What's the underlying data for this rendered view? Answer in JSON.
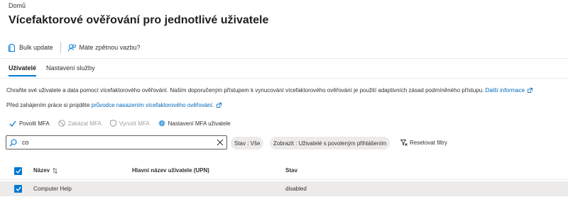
{
  "breadcrumb": "Domů",
  "page_title": "Vícefaktorové ověřování pro jednotlivé uživatele",
  "title_more": "···",
  "toolbar": {
    "bulk_update": "Bulk update",
    "feedback": "Máte zpětnou vazbu?"
  },
  "tabs": [
    {
      "label": "Uživatelé",
      "active": true
    },
    {
      "label": "Nastavení služby",
      "active": false
    }
  ],
  "description": {
    "text": "Chraňte své uživatele a data pomocí vícefaktorového ověřování. Naším doporučeným přístupem k vynucování vícefaktorového ověřování je použití adaptivních zásad podmíněného přístupu.",
    "link": "Další informace"
  },
  "guide": {
    "text": "Před zahájením práce si projděte",
    "link": "průvodce nasazením vícefaktorového ověřování."
  },
  "actions": {
    "enable": "Povolit MFA",
    "disable": "Zakázat MFA",
    "enforce": "Vynutit MFA",
    "settings": "Nastavení MFA uživatele"
  },
  "search": {
    "value": "co"
  },
  "filters": {
    "status": "Stav : Vše",
    "show": "Zobrazit : Uživatelé s povoleným přihlášením",
    "reset": "Resetovat filtry"
  },
  "table": {
    "headers": {
      "name": "Název",
      "upn": "Hlavní název uživatele (UPN)",
      "status": "Stav"
    },
    "rows": [
      {
        "name": "Computer Help",
        "upn": "",
        "status": "disabled",
        "selected": true
      }
    ]
  },
  "colors": {
    "accent": "#0078d4",
    "link": "#0067b8",
    "selected_row": "#edebe9"
  }
}
